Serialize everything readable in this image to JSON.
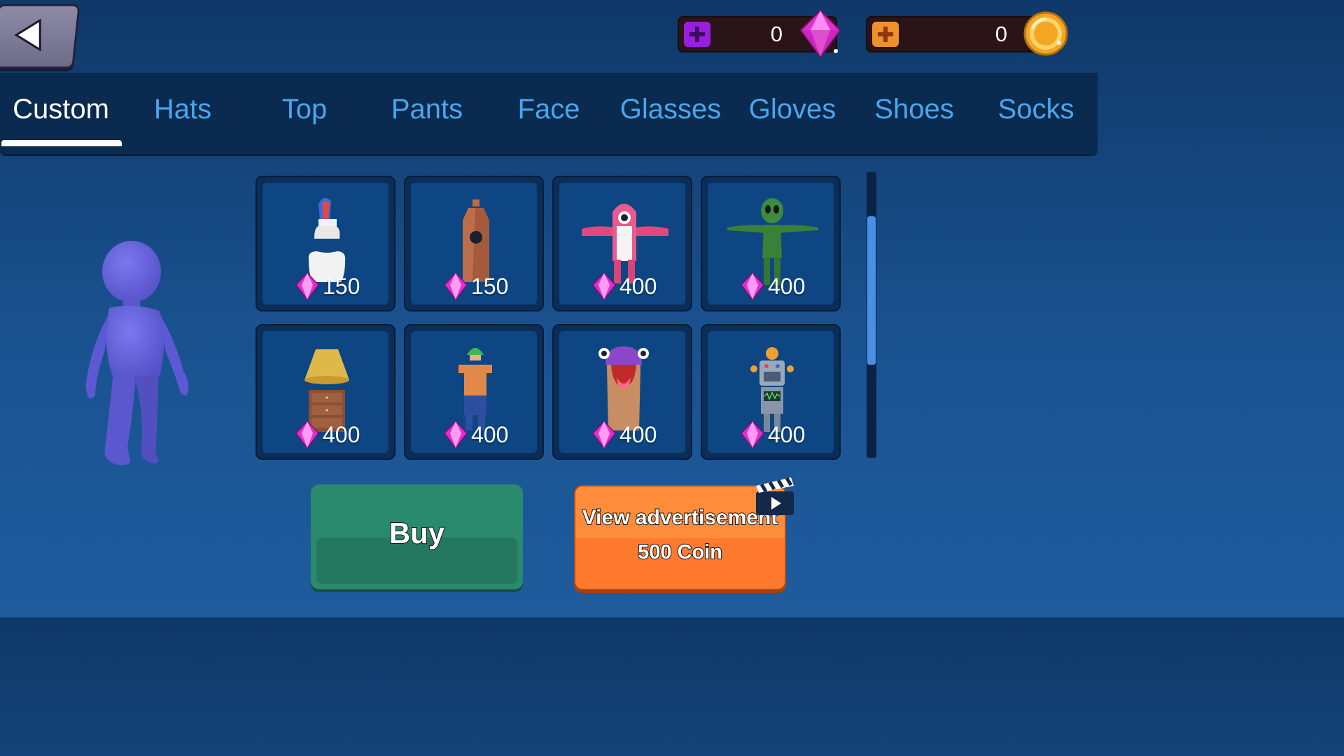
{
  "header": {
    "back_icon": "back-arrow-icon"
  },
  "currency": [
    {
      "name": "gems",
      "amount": "0",
      "plus_color": "#9a1ee0",
      "icon": "gem-icon"
    },
    {
      "name": "coins",
      "amount": "0",
      "plus_color": "#f0902c",
      "icon": "coin-icon"
    }
  ],
  "tabs": [
    {
      "label": "Custom",
      "active": true
    },
    {
      "label": "Hats",
      "active": false
    },
    {
      "label": "Top",
      "active": false
    },
    {
      "label": "Pants",
      "active": false
    },
    {
      "label": "Face",
      "active": false
    },
    {
      "label": "Glasses",
      "active": false
    },
    {
      "label": "Gloves",
      "active": false
    },
    {
      "label": "Shoes",
      "active": false
    },
    {
      "label": "Socks",
      "active": false
    }
  ],
  "items": [
    {
      "icon": "toothpaste-tooth-costume-icon",
      "price": "150"
    },
    {
      "icon": "bottle-costume-icon",
      "price": "150"
    },
    {
      "icon": "pink-shark-costume-icon",
      "price": "400"
    },
    {
      "icon": "green-alien-costume-icon",
      "price": "400"
    },
    {
      "icon": "lamp-dresser-costume-icon",
      "price": "400"
    },
    {
      "icon": "worker-costume-icon",
      "price": "400"
    },
    {
      "icon": "purple-monster-costume-icon",
      "price": "400"
    },
    {
      "icon": "robot-costume-icon",
      "price": "400"
    }
  ],
  "scroll": {
    "thumb_fraction": 0.52,
    "position_fraction": 0.32
  },
  "buttons": {
    "buy_label": "Buy",
    "ad_label": "View advertisement",
    "ad_reward": "500 Coin"
  },
  "colors": {
    "gem": "#e83ad8",
    "coin": "#f5a623",
    "buy": "#2a8a6c",
    "ad": "#ff7a2e"
  }
}
